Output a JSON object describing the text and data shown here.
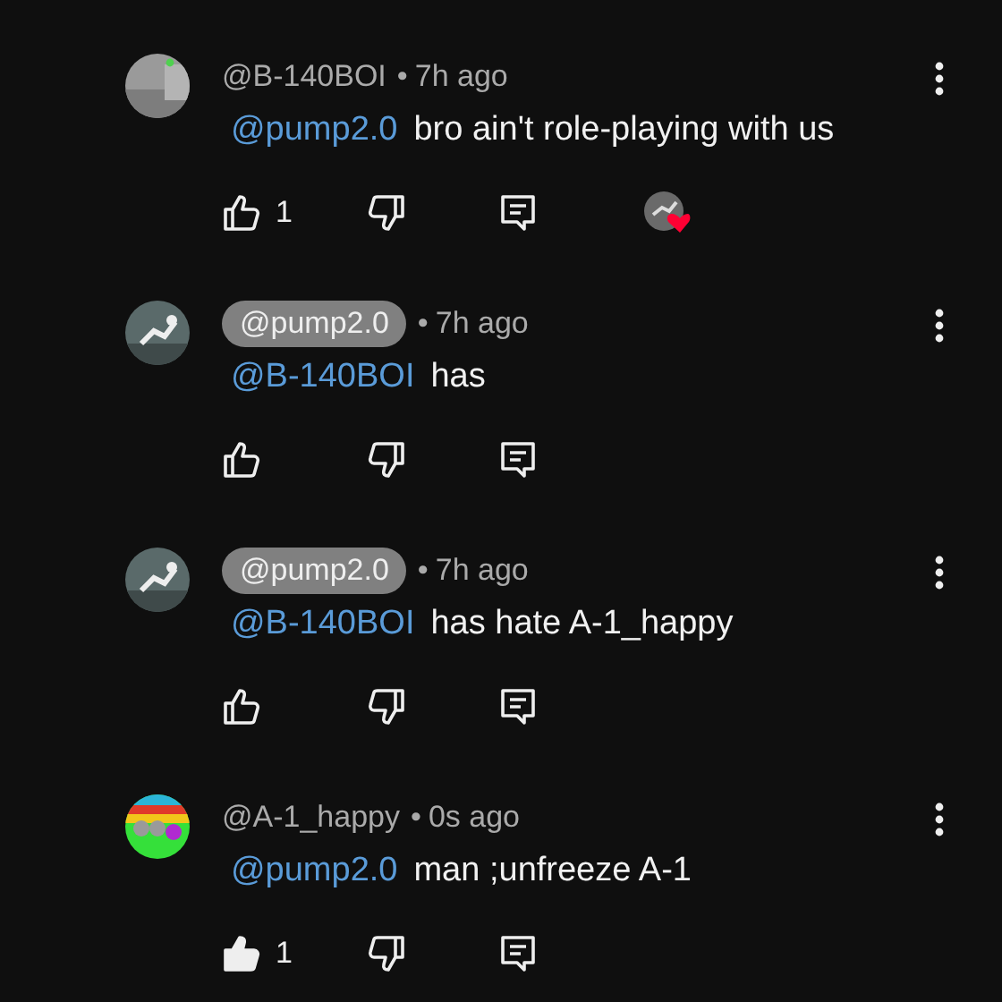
{
  "comments": [
    {
      "author": "@B-140BOI",
      "author_highlighted": false,
      "separator": "•",
      "time": "7h ago",
      "mention": "@pump2.0",
      "text": "bro ain't role-playing with us",
      "likes": "1",
      "liked": false,
      "hearted": true
    },
    {
      "author": "@pump2.0",
      "author_highlighted": true,
      "separator": "•",
      "time": "7h ago",
      "mention": "@B-140BOI",
      "text": "has",
      "liked": false,
      "hearted": false
    },
    {
      "author": "@pump2.0",
      "author_highlighted": true,
      "separator": "•",
      "time": "7h ago",
      "mention": "@B-140BOI",
      "text": "has hate A-1_happy",
      "liked": false,
      "hearted": false
    },
    {
      "author": "@A-1_happy",
      "author_highlighted": false,
      "separator": "•",
      "time": "0s ago",
      "mention": "@pump2.0",
      "text": "man ;unfreeze A-1",
      "likes": "1",
      "liked": true,
      "hearted": false
    }
  ]
}
